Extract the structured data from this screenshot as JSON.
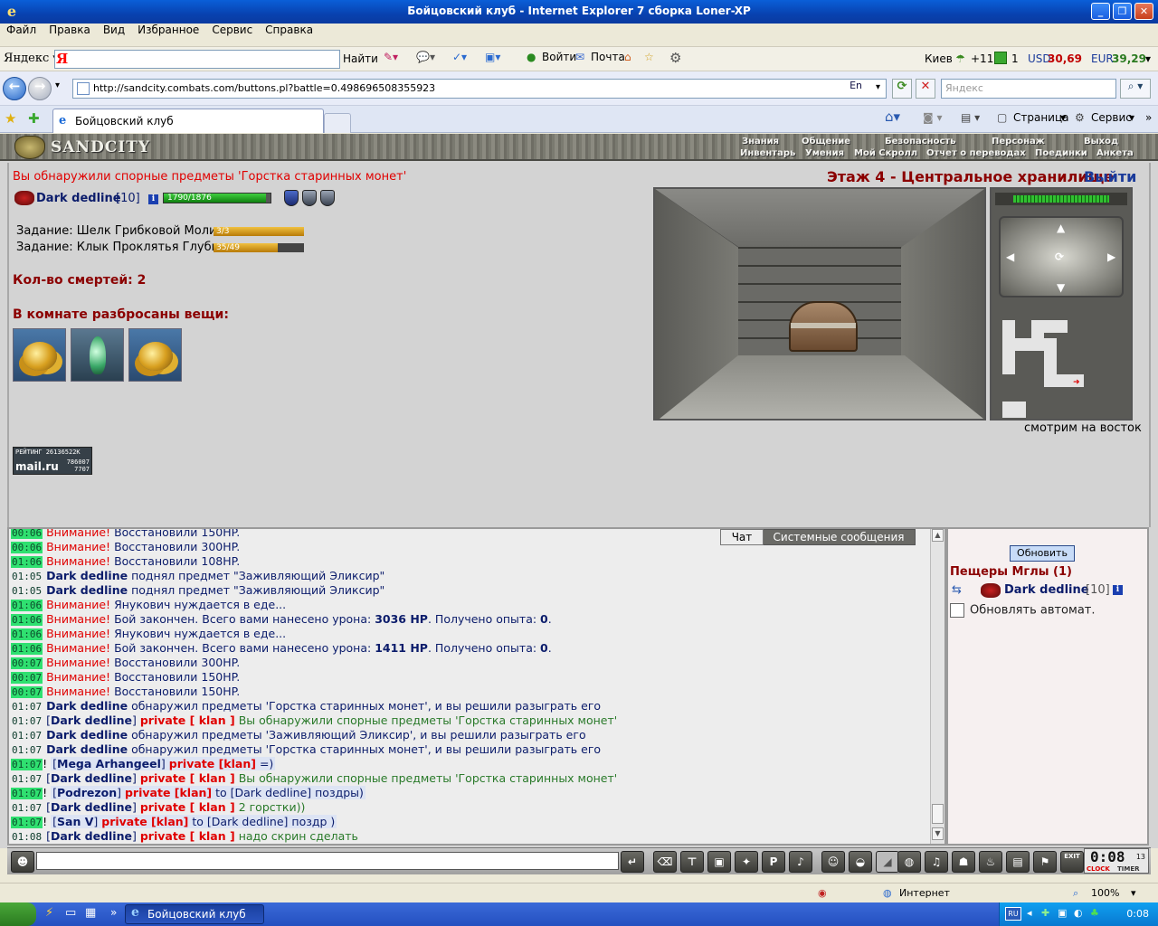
{
  "window": {
    "title": "Бойцовский клуб - Internet Explorer 7 сборка Loner-XP"
  },
  "menu": [
    "Файл",
    "Правка",
    "Вид",
    "Избранное",
    "Сервис",
    "Справка"
  ],
  "yandex_bar": {
    "brand": "Яндекс",
    "logo_letter": "Я",
    "find_label": "Найти",
    "login_label": "Войти",
    "mail_label": "Почта",
    "city": "Киев",
    "temp": "+11",
    "count": "1",
    "usd_label": "USD",
    "usd_value": "30,69",
    "eur_label": "EUR",
    "eur_value": "39,29"
  },
  "address_bar": {
    "url": "http://sandcity.combats.com/buttons.pl?battle=0.498696508355923",
    "lang": "En",
    "search_placeholder": "Яндекс"
  },
  "tabs": {
    "active_label": "Бойцовский клуб"
  },
  "tab_tools": {
    "page_label": "Страница",
    "service_label": "Сервис"
  },
  "game": {
    "logo": "SANDCITY",
    "top_nav": [
      "Знания",
      "Общение",
      "Безопасность",
      "Персонаж",
      "Выход"
    ],
    "sub_nav": [
      "Инвентарь",
      "Умения",
      "Мой Скролл",
      "Отчет о переводах",
      "Поединки",
      "Анкета"
    ],
    "notice": "Вы обнаружили спорные предметы 'Горстка старинных монет'",
    "player": {
      "name": "Dark dedline",
      "level": "[10]",
      "hp_text": "1790/1876",
      "hp_current": 1790,
      "hp_max": 1876
    },
    "tasks": [
      {
        "label": "Задание:  Шелк Грибковой Моли",
        "progress": "3/3",
        "done": 3,
        "total": 3
      },
      {
        "label": "Задание: Клык Проклятья Глубин",
        "progress": "35/49",
        "done": 35,
        "total": 49
      }
    ],
    "deaths": "Кол-во смертей: 2",
    "items_title": "В комнате разбросаны вещи:",
    "floor_title": "Этаж 4 - Центральное хранилище",
    "exit_label": "Выйти",
    "look_direction": "смотрим на восток",
    "rating": {
      "line1": "РЕЙТИНГ 26136522K",
      "brand": "mail.ru",
      "n1": "786007",
      "n2": "7707"
    }
  },
  "chat": {
    "tabs": [
      "Чат",
      "Системные сообщения"
    ],
    "warn_label": "Внимание!",
    "private_label": "private [ klan ]",
    "private_short": "private [klan]"
  },
  "chat_lines": {
    "l0": {
      "ts": "00:06",
      "text": "Восстановили 150HP."
    },
    "l1": {
      "ts": "00:06",
      "text": "Восстановили 300HP."
    },
    "l2": {
      "ts": "01:06",
      "text": "Восстановили 108HP."
    },
    "l3": {
      "ts": "01:05",
      "name": "Dark dedline",
      "text": "поднял предмет \"Заживляющий Эликсир\""
    },
    "l4": {
      "ts": "01:05",
      "name": "Dark dedline",
      "text": "поднял предмет \"Заживляющий Эликсир\""
    },
    "l5": {
      "ts": "01:06",
      "text": "Янукович нуждается в еде..."
    },
    "l6": {
      "ts": "01:06",
      "pre": "Бой закончен. Всего вами нанесено урона:",
      "dmg": "3036 HP",
      "mid": ". Получено опыта:",
      "exp": "0",
      "post": "."
    },
    "l7": {
      "ts": "01:06",
      "text": "Янукович нуждается в еде..."
    },
    "l8": {
      "ts": "01:06",
      "pre": "Бой закончен. Всего вами нанесено урона:",
      "dmg": "1411 HP",
      "mid": ". Получено опыта:",
      "exp": "0",
      "post": "."
    },
    "l9": {
      "ts": "00:07",
      "text": "Восстановили 300HP."
    },
    "l10": {
      "ts": "00:07",
      "text": "Восстановили 150HP."
    },
    "l11": {
      "ts": "00:07",
      "text": "Восстановили 150HP."
    },
    "l12": {
      "ts": "01:07",
      "name": "Dark dedline",
      "text": "обнаружил предметы 'Горстка старинных монет', и вы решили разыграть его"
    },
    "l13": {
      "ts": "01:07",
      "name": "Dark dedline",
      "text": "Вы обнаружили спорные предметы 'Горстка старинных монет'"
    },
    "l14": {
      "ts": "01:07",
      "name": "Dark dedline",
      "text": "обнаружил предметы 'Заживляющий Эликсир', и вы решили разыграть его"
    },
    "l15": {
      "ts": "01:07",
      "name": "Dark dedline",
      "text": "обнаружил предметы 'Горстка старинных монет', и вы решили разыграть его"
    },
    "l16": {
      "ts": "01:07",
      "name": "Mega Arhangeel",
      "text": "=)"
    },
    "l17": {
      "ts": "01:07",
      "name": "Dark dedline",
      "text": "Вы обнаружили спорные предметы 'Горстка старинных монет'"
    },
    "l18": {
      "ts": "01:07",
      "name": "Podrezon",
      "text": "to [Dark dedline] поздры)"
    },
    "l19": {
      "ts": "01:07",
      "name": "Dark dedline",
      "text": "2 горстки))"
    },
    "l20": {
      "ts": "01:07",
      "name": "San V",
      "text": "to [Dark dedline] поздр )"
    },
    "l21": {
      "ts": "01:08",
      "name": "Dark dedline",
      "text": "надо скрин сделать"
    }
  },
  "who": {
    "refresh_label": "Обновить",
    "location": "Пещеры Мглы (1)",
    "user_name": "Dark dedline",
    "user_level": "[10]",
    "auto_label": "Обновлять автомат."
  },
  "gamebar": {
    "clock_time": "0:08",
    "clock_sec": "13",
    "clock_label": "CLOCK",
    "timer_label": "TIMER",
    "exit_tag": "EXIT"
  },
  "statusbar": {
    "zone": "Интернет",
    "zoom": "100%"
  },
  "taskbar": {
    "task_label": "Бойцовский клуб -...",
    "lang": "RU",
    "clock": "0:08"
  },
  "colors": {
    "accent_red": "#e00000",
    "name_blue": "#0b1c6b",
    "timestamp_highlight": "#2fe070"
  }
}
